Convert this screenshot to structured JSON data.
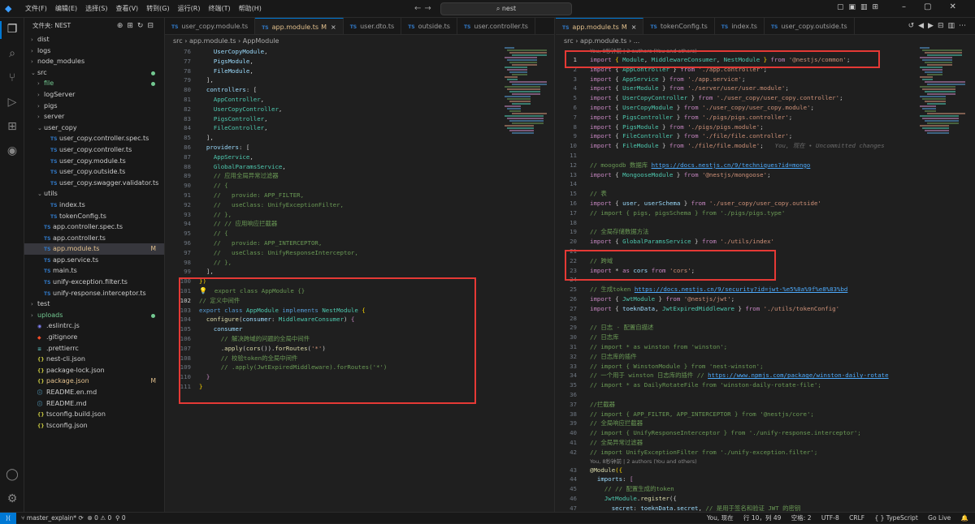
{
  "titlebar": {
    "menu": [
      "文件(F)",
      "编辑(E)",
      "选择(S)",
      "查看(V)",
      "转到(G)",
      "运行(R)",
      "终端(T)",
      "帮助(H)"
    ],
    "search": "nest"
  },
  "explorer": {
    "title": "文件夹: NEST",
    "tree": [
      {
        "label": "dist",
        "depth": 0,
        "arrow": "›",
        "type": "folder"
      },
      {
        "label": "logs",
        "depth": 0,
        "arrow": "›",
        "type": "folder"
      },
      {
        "label": "node_modules",
        "depth": 0,
        "arrow": "›",
        "type": "folder"
      },
      {
        "label": "src",
        "depth": 0,
        "arrow": "⌄",
        "type": "folder",
        "dot": true
      },
      {
        "label": "file",
        "depth": 1,
        "arrow": "›",
        "type": "folder",
        "color": "#73c991",
        "dot": true
      },
      {
        "label": "logServer",
        "depth": 1,
        "arrow": "›",
        "type": "folder"
      },
      {
        "label": "pigs",
        "depth": 1,
        "arrow": "›",
        "type": "folder"
      },
      {
        "label": "server",
        "depth": 1,
        "arrow": "›",
        "type": "folder"
      },
      {
        "label": "user_copy",
        "depth": 1,
        "arrow": "⌄",
        "type": "folder"
      },
      {
        "label": "user_copy.controller.spec.ts",
        "depth": 2,
        "type": "ts"
      },
      {
        "label": "user_copy.controller.ts",
        "depth": 2,
        "type": "ts"
      },
      {
        "label": "user_copy.module.ts",
        "depth": 2,
        "type": "ts"
      },
      {
        "label": "user_copy.outside.ts",
        "depth": 2,
        "type": "ts"
      },
      {
        "label": "user_copy.swagger.validator.ts",
        "depth": 2,
        "type": "ts"
      },
      {
        "label": "utils",
        "depth": 1,
        "arrow": "⌄",
        "type": "folder"
      },
      {
        "label": "index.ts",
        "depth": 2,
        "type": "ts"
      },
      {
        "label": "tokenConfig.ts",
        "depth": 2,
        "type": "ts"
      },
      {
        "label": "app.controller.spec.ts",
        "depth": 1,
        "type": "ts"
      },
      {
        "label": "app.controller.ts",
        "depth": 1,
        "type": "ts"
      },
      {
        "label": "app.module.ts",
        "depth": 1,
        "type": "ts",
        "badge": "M",
        "selected": true,
        "color": "#e2c08d"
      },
      {
        "label": "app.service.ts",
        "depth": 1,
        "type": "ts"
      },
      {
        "label": "main.ts",
        "depth": 1,
        "type": "ts"
      },
      {
        "label": "unify-exception.filter.ts",
        "depth": 1,
        "type": "ts"
      },
      {
        "label": "unify-response.interceptor.ts",
        "depth": 1,
        "type": "ts"
      },
      {
        "label": "test",
        "depth": 0,
        "arrow": "›",
        "type": "folder"
      },
      {
        "label": "uploads",
        "depth": 0,
        "arrow": "›",
        "type": "folder",
        "color": "#73c991",
        "dot": true
      },
      {
        "label": ".eslintrc.js",
        "depth": 0,
        "type": "eslint"
      },
      {
        "label": ".gitignore",
        "depth": 0,
        "type": "git"
      },
      {
        "label": ".prettierrc",
        "depth": 0,
        "type": "pretty"
      },
      {
        "label": "nest-cli.json",
        "depth": 0,
        "type": "json"
      },
      {
        "label": "package-lock.json",
        "depth": 0,
        "type": "json"
      },
      {
        "label": "package.json",
        "depth": 0,
        "type": "json",
        "badge": "M",
        "color": "#e2c08d"
      },
      {
        "label": "README.en.md",
        "depth": 0,
        "type": "md"
      },
      {
        "label": "README.md",
        "depth": 0,
        "type": "md"
      },
      {
        "label": "tsconfig.build.json",
        "depth": 0,
        "type": "json"
      },
      {
        "label": "tsconfig.json",
        "depth": 0,
        "type": "json"
      }
    ]
  },
  "editor_left": {
    "tabs": [
      {
        "label": "user_copy.module.ts",
        "active": false
      },
      {
        "label": "app.module.ts",
        "active": true,
        "modified": "M"
      },
      {
        "label": "user.dto.ts",
        "active": false
      },
      {
        "label": "outside.ts",
        "active": false
      },
      {
        "label": "user.controller.ts",
        "active": false
      }
    ],
    "breadcrumb": [
      "src",
      "app.module.ts",
      "AppModule"
    ],
    "lines": [
      {
        "n": "76",
        "h": "    <span class='v'>UserCopyModule</span>,"
      },
      {
        "n": "77",
        "h": "    <span class='v'>PigsModule</span>,"
      },
      {
        "n": "78",
        "h": "    <span class='v'>FileModule</span>,"
      },
      {
        "n": "79",
        "h": "  ],"
      },
      {
        "n": "80",
        "h": "  <span class='v'>controllers</span>: ["
      },
      {
        "n": "81",
        "h": "    <span class='t'>AppController</span>,"
      },
      {
        "n": "82",
        "h": "    <span class='t'>UserCopyController</span>,"
      },
      {
        "n": "83",
        "h": "    <span class='t'>PigsController</span>,"
      },
      {
        "n": "84",
        "h": "    <span class='t'>FileController</span>,"
      },
      {
        "n": "85",
        "h": "  ],"
      },
      {
        "n": "86",
        "h": "  <span class='v'>providers</span>: ["
      },
      {
        "n": "87",
        "h": "    <span class='t'>AppService</span>,"
      },
      {
        "n": "88",
        "h": "    <span class='t'>GlobalParamsService</span>,"
      },
      {
        "n": "89",
        "h": "    <span class='cm'>// 应用全局异常过滤器</span>"
      },
      {
        "n": "90",
        "h": "    <span class='cm'>// {</span>"
      },
      {
        "n": "91",
        "h": "    <span class='cm'>//   provide: APP_FILTER,</span>"
      },
      {
        "n": "92",
        "h": "    <span class='cm'>//   useClass: UnifyExceptionFilter,</span>"
      },
      {
        "n": "93",
        "h": "    <span class='cm'>// },</span>"
      },
      {
        "n": "94",
        "h": "    <span class='cm'>// // 应用响应拦截器</span>"
      },
      {
        "n": "95",
        "h": "    <span class='cm'>// {</span>"
      },
      {
        "n": "96",
        "h": "    <span class='cm'>//   provide: APP_INTERCEPTOR,</span>"
      },
      {
        "n": "97",
        "h": "    <span class='cm'>//   useClass: UnifyResponseInterceptor,</span>"
      },
      {
        "n": "98",
        "h": "    <span class='cm'>// },</span>"
      },
      {
        "n": "99",
        "h": "  ],"
      },
      {
        "n": "100",
        "h": "<span class='b'>})</span>"
      },
      {
        "n": "101",
        "h": "  <span class='cm'>export class AppModule {}</span>",
        "bulb": true
      },
      {
        "n": "102",
        "h": "<span class='cm'>// 定义中间件</span>",
        "cur": true
      },
      {
        "n": "103",
        "h": "<span class='k'>export</span> <span class='k'>class</span> <span class='t'>AppModule</span> <span class='k'>implements</span> <span class='t'>NestModule</span> <span class='b'>{</span>"
      },
      {
        "n": "104",
        "h": "  <span class='f'>configure</span>(<span class='v'>consumer</span>: <span class='t'>MiddlewareConsumer</span>) <span class='c'>{</span>"
      },
      {
        "n": "105",
        "h": "    <span class='v'>consumer</span>"
      },
      {
        "n": "106",
        "h": "      <span class='cm'>// 解决跨域的问题的全局中间件</span>"
      },
      {
        "n": "107",
        "h": "      .<span class='f'>apply</span>(<span class='f'>cors</span>()).<span class='f'>forRoutes</span>(<span class='s'>'*'</span>)"
      },
      {
        "n": "108",
        "h": "      <span class='cm'>// 校验token的全局中间件</span>"
      },
      {
        "n": "109",
        "h": "      <span class='cm'>// .apply(JwtExpiredMiddleware).forRoutes('*')</span>"
      },
      {
        "n": "110",
        "h": "  <span class='c'>}</span>"
      },
      {
        "n": "111",
        "h": "<span class='b'>}</span>"
      }
    ]
  },
  "editor_right": {
    "tabs": [
      {
        "label": "app.module.ts",
        "active": true,
        "modified": "M"
      },
      {
        "label": "tokenConfig.ts",
        "active": false
      },
      {
        "label": "index.ts",
        "active": false
      },
      {
        "label": "user_copy.outside.ts",
        "active": false
      }
    ],
    "breadcrumb": [
      "src",
      "app.module.ts",
      "..."
    ],
    "blame_top": "You, 8秒钟前 | 2 authors (You and others)",
    "blame_mid": "You, 8秒钟前 | 2 authors (You and others)",
    "inline_blame": "You, 现在 • Uncommitted changes",
    "lines": [
      {
        "n": "1",
        "h": "<span class='c'>import</span> <span class='b'>{</span> <span class='t'>Module</span>, <span class='t'>MiddlewareConsumer</span>, <span class='t'>NestModule</span> <span class='b'>}</span> <span class='c'>from</span> <span class='s'>'@nestjs/common'</span>;",
        "cur": true
      },
      {
        "n": "2",
        "h": "<span class='c'>import</span> { <span class='t'>AppController</span> } <span class='c'>from</span> <span class='s'>'./app.controller'</span>;"
      },
      {
        "n": "3",
        "h": "<span class='c'>import</span> { <span class='t'>AppService</span> } <span class='c'>from</span> <span class='s'>'./app.service'</span>;"
      },
      {
        "n": "4",
        "h": "<span class='c'>import</span> { <span class='t'>UserModule</span> } <span class='c'>from</span> <span class='s'>'./server/user/user.module'</span>;"
      },
      {
        "n": "5",
        "h": "<span class='c'>import</span> { <span class='t'>UserCopyController</span> } <span class='c'>from</span> <span class='s'>'./user_copy/user_copy.controller'</span>;"
      },
      {
        "n": "6",
        "h": "<span class='c'>import</span> { <span class='t'>UserCopyModule</span> } <span class='c'>from</span> <span class='s'>'./user_copy/user_copy.module'</span>;"
      },
      {
        "n": "7",
        "h": "<span class='c'>import</span> { <span class='t'>PigsController</span> } <span class='c'>from</span> <span class='s'>'./pigs/pigs.controller'</span>;"
      },
      {
        "n": "8",
        "h": "<span class='c'>import</span> { <span class='t'>PigsModule</span> } <span class='c'>from</span> <span class='s'>'./pigs/pigs.module'</span>;"
      },
      {
        "n": "9",
        "h": "<span class='c'>import</span> { <span class='t'>FileController</span> } <span class='c'>from</span> <span class='s'>'./file/file.controller'</span>;"
      },
      {
        "n": "10",
        "h": "<span class='c'>import</span> { <span class='t'>FileModule</span> } <span class='c'>from</span> <span class='s'>'./file/file.module'</span>;",
        "inline": true
      },
      {
        "n": "11",
        "h": ""
      },
      {
        "n": "12",
        "h": "<span class='cm'>// moogodb 数据库 </span><span class='u'>https://docs.nestjs.cn/9/techniques?id=mongo</span>"
      },
      {
        "n": "13",
        "h": "<span class='c'>import</span> { <span class='t'>MongooseModule</span> } <span class='c'>from</span> <span class='s'>'@nestjs/mongoose'</span>;"
      },
      {
        "n": "14",
        "h": ""
      },
      {
        "n": "15",
        "h": "<span class='cm'>// 表</span>"
      },
      {
        "n": "16",
        "h": "<span class='c'>import</span> { <span class='v'>user</span>, <span class='v'>userSchema</span> } <span class='c'>from</span> <span class='s'>'./user_copy/user_copy.outside'</span>"
      },
      {
        "n": "17",
        "h": "<span class='cm'>// import { pigs, pigsSchema } from './pigs/pigs.type'</span>"
      },
      {
        "n": "18",
        "h": ""
      },
      {
        "n": "19",
        "h": "<span class='cm'>// 全局存储数据方法</span>"
      },
      {
        "n": "20",
        "h": "<span class='c'>import</span> { <span class='t'>GlobalParamsService</span> } <span class='c'>from</span> <span class='s'>'./utils/index'</span>"
      },
      {
        "n": "21",
        "h": ""
      },
      {
        "n": "22",
        "h": "<span class='cm'>// 跨域</span>"
      },
      {
        "n": "23",
        "h": "<span class='c'>import</span> * <span class='c'>as</span> <span class='v'>cors</span> <span class='c'>from</span> <span class='s'>'cors'</span>;"
      },
      {
        "n": "24",
        "h": ""
      },
      {
        "n": "25",
        "h": "<span class='cm'>// 生成token </span><span class='u'>https://docs.nestjs.cn/9/security?id=jwt-%e5%8a%9f%e8%83%bd</span>"
      },
      {
        "n": "26",
        "h": "<span class='c'>import</span> { <span class='t'>JwtModule</span> } <span class='c'>from</span> <span class='s'>'@nestjs/jwt'</span>;"
      },
      {
        "n": "27",
        "h": "<span class='c'>import</span> { <span class='v'>toeknData</span>, <span class='t'>JwtExpiredMiddleware</span> } <span class='c'>from</span> <span class='s'>'./utils/tokenConfig'</span>"
      },
      {
        "n": "28",
        "h": ""
      },
      {
        "n": "29",
        "h": "<span class='cm'>// 日志 - 配置自描述</span>"
      },
      {
        "n": "30",
        "h": "<span class='cm'>// 日志库</span>"
      },
      {
        "n": "31",
        "h": "<span class='cm'>// import * as winston from 'winston';</span>"
      },
      {
        "n": "32",
        "h": "<span class='cm'>// 日志库的插件</span>"
      },
      {
        "n": "33",
        "h": "<span class='cm'>// import { WinstonModule } from 'nest-winston';</span>"
      },
      {
        "n": "34",
        "h": "<span class='cm'>// 一个用于 winston 日志库的插件 // </span><span class='u'>https://www.npmjs.com/package/winston-daily-rotate</span>"
      },
      {
        "n": "35",
        "h": "<span class='cm'>// import * as DailyRotateFile from 'winston-daily-rotate-file';</span>"
      },
      {
        "n": "36",
        "h": ""
      },
      {
        "n": "37",
        "h": "<span class='cm'>//拦截器</span>"
      },
      {
        "n": "38",
        "h": "<span class='cm'>// import { APP_FILTER, APP_INTERCEPTOR } from '@nestjs/core';</span>"
      },
      {
        "n": "39",
        "h": "<span class='cm'>// 全局响应拦截器</span>"
      },
      {
        "n": "40",
        "h": "<span class='cm'>// import { UnifyResponseInterceptor } from './unify-response.interceptor';</span>"
      },
      {
        "n": "41",
        "h": "<span class='cm'>// 全局异常过滤器</span>"
      },
      {
        "n": "42",
        "h": "<span class='cm'>// import UnifyExceptionFilter from './unify-exception.filter';</span>",
        "blameAfter": true
      },
      {
        "n": "43",
        "h": "<span class='f'>@Module</span><span class='b'>({</span>"
      },
      {
        "n": "44",
        "h": "  <span class='v'>imports</span>: <span class='c'>[</span>"
      },
      {
        "n": "45",
        "h": "    <span class='cm'>// // 配置生成的token</span>"
      },
      {
        "n": "46",
        "h": "    <span class='t'>JwtModule</span>.<span class='f'>register</span>({"
      },
      {
        "n": "47",
        "h": "      <span class='v'>secret</span>: <span class='v'>toeknData</span>.<span class='v'>secret</span>, <span class='cm'>// 是用于签名和验证 JWT 的密钥</span>"
      }
    ]
  },
  "statusbar": {
    "branch": "master_explain*",
    "sync": "⟳",
    "errors": "⊗ 0 ⚠ 0",
    "ports": "⚲ 0",
    "blame": "You, 现在",
    "position": "行 10，列 49",
    "spaces": "空格: 2",
    "encoding": "UTF-8",
    "eol": "CRLF",
    "lang": "{ } TypeScript",
    "golive": "Go Live"
  },
  "colors": {
    "accent": "#0078d4",
    "highlight_box": "#e53935",
    "modified": "#e2c08d",
    "untracked": "#73c991"
  }
}
